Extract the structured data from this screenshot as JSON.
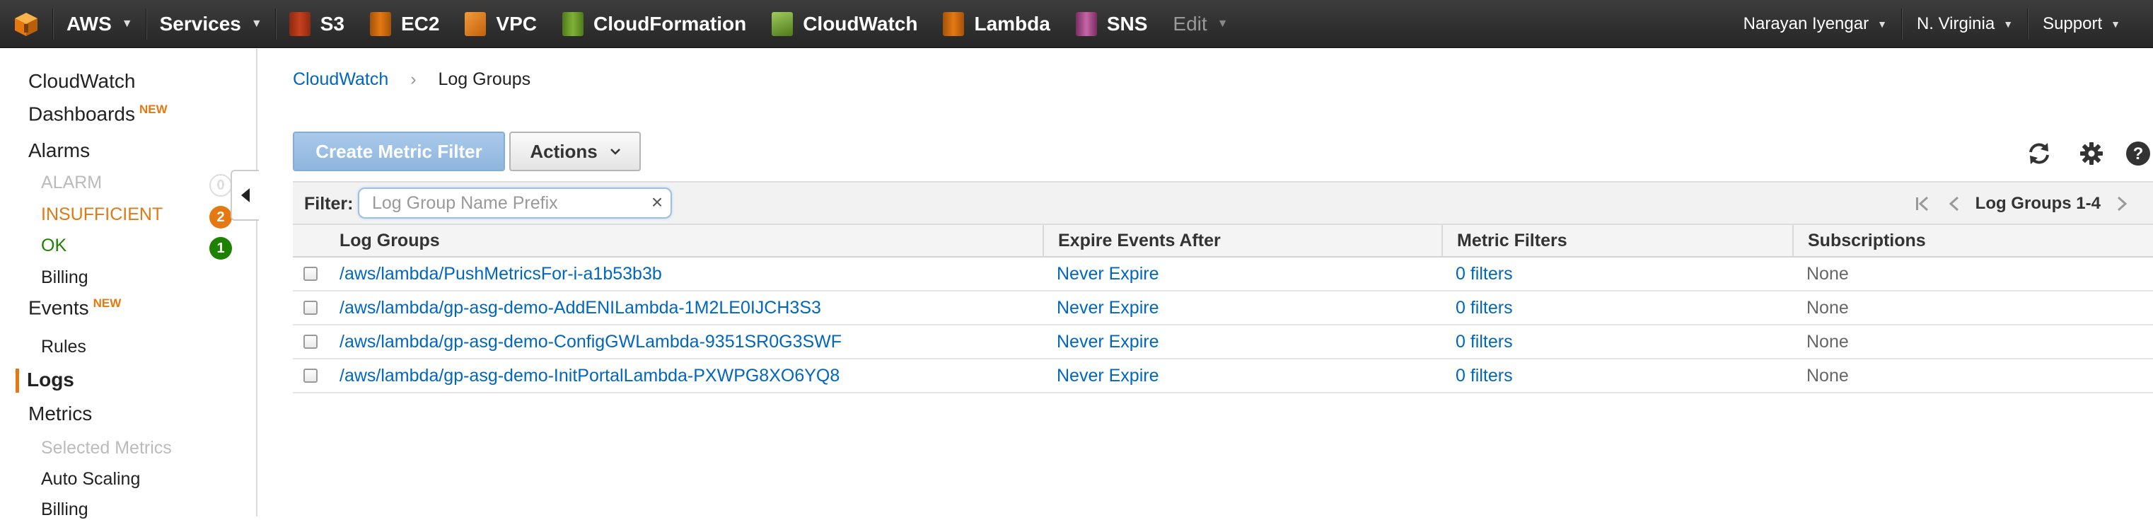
{
  "nav": {
    "aws_label": "AWS",
    "services_label": "Services",
    "services": [
      {
        "label": "S3",
        "icon": "s3-icon",
        "color": "#c7401d"
      },
      {
        "label": "EC2",
        "icon": "ec2-icon",
        "color": "#e47911"
      },
      {
        "label": "VPC",
        "icon": "vpc-icon",
        "color": "#e47911"
      },
      {
        "label": "CloudFormation",
        "icon": "cloudformation-icon",
        "color": "#6b9d2a"
      },
      {
        "label": "CloudWatch",
        "icon": "cloudwatch-icon",
        "color": "#6b9d2a"
      },
      {
        "label": "Lambda",
        "icon": "lambda-icon",
        "color": "#e47911"
      },
      {
        "label": "SNS",
        "icon": "sns-icon",
        "color": "#b04a8c"
      }
    ],
    "edit_label": "Edit",
    "user": "Narayan Iyengar",
    "region": "N. Virginia",
    "support": "Support"
  },
  "sidebar": {
    "cloudwatch": "CloudWatch",
    "dashboards": "Dashboards",
    "new_badge": "NEW",
    "alarms": "Alarms",
    "alarm": "ALARM",
    "alarm_count": "0",
    "insufficient": "INSUFFICIENT",
    "insufficient_count": "2",
    "ok": "OK",
    "ok_count": "1",
    "billing": "Billing",
    "events": "Events",
    "rules": "Rules",
    "logs": "Logs",
    "metrics": "Metrics",
    "selected_metrics": "Selected Metrics",
    "auto_scaling": "Auto Scaling",
    "billing_metrics": "Billing"
  },
  "breadcrumb": {
    "root": "CloudWatch",
    "separator": "›",
    "current": "Log Groups"
  },
  "toolbar": {
    "create_metric_filter": "Create Metric Filter",
    "actions": "Actions"
  },
  "filter": {
    "label": "Filter:",
    "placeholder": "Log Group Name Prefix",
    "clear": "×",
    "pagination": "Log Groups 1-4"
  },
  "table": {
    "columns": [
      "Log Groups",
      "Expire Events After",
      "Metric Filters",
      "Subscriptions"
    ],
    "rows": [
      {
        "name": "/aws/lambda/PushMetricsFor-i-a1b53b3b",
        "expire": "Never Expire",
        "filters": "0 filters",
        "subscriptions": "None"
      },
      {
        "name": "/aws/lambda/gp-asg-demo-AddENILambda-1M2LE0IJCH3S3",
        "expire": "Never Expire",
        "filters": "0 filters",
        "subscriptions": "None"
      },
      {
        "name": "/aws/lambda/gp-asg-demo-ConfigGWLambda-9351SR0G3SWF",
        "expire": "Never Expire",
        "filters": "0 filters",
        "subscriptions": "None"
      },
      {
        "name": "/aws/lambda/gp-asg-demo-InitPortalLambda-PXWPG8XO6YQ8",
        "expire": "Never Expire",
        "filters": "0 filters",
        "subscriptions": "None"
      }
    ]
  },
  "colors": {
    "link": "#0066c0",
    "insufficient": "#e47911",
    "ok": "#1d8102",
    "nav_bg": "#2e2e2e"
  }
}
